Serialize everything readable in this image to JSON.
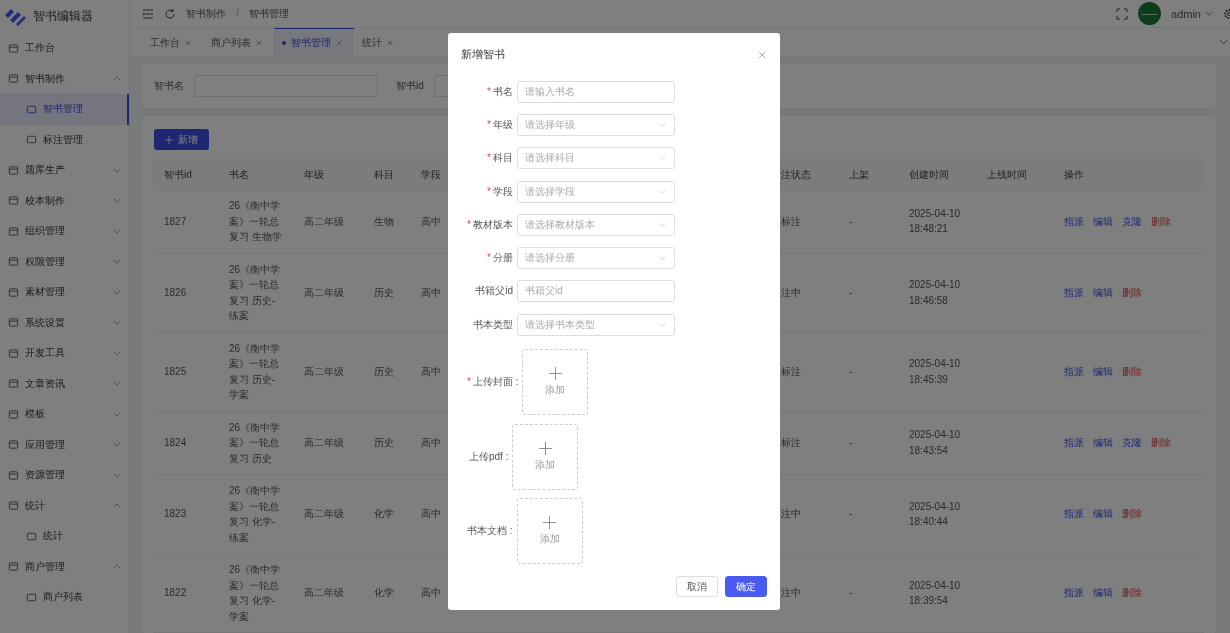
{
  "app": {
    "title": "智书编辑器"
  },
  "sidebar": {
    "items": [
      {
        "label": "工作台"
      },
      {
        "label": "智书制作",
        "expanded": true,
        "children": [
          {
            "label": "智书管理",
            "selected": true
          },
          {
            "label": "标注管理",
            "selected": false
          }
        ]
      },
      {
        "label": "题库生产",
        "expanded": false
      },
      {
        "label": "校本制作",
        "expanded": false
      },
      {
        "label": "组织管理",
        "expanded": false
      },
      {
        "label": "权限管理",
        "expanded": false
      },
      {
        "label": "素材管理",
        "expanded": false
      },
      {
        "label": "系统设置",
        "expanded": false
      },
      {
        "label": "开发工具",
        "expanded": false
      },
      {
        "label": "文章资讯",
        "expanded": false
      },
      {
        "label": "模板",
        "expanded": false
      },
      {
        "label": "应用管理",
        "expanded": false
      },
      {
        "label": "资源管理",
        "expanded": false
      },
      {
        "label": "统计",
        "expanded": true,
        "children": [
          {
            "label": "统计",
            "selected": false
          }
        ]
      },
      {
        "label": "商户管理",
        "expanded": true,
        "children": [
          {
            "label": "商户列表",
            "selected": false
          }
        ]
      }
    ]
  },
  "header": {
    "breadcrumb": [
      "智书制作",
      "智书管理"
    ],
    "separator": "/",
    "user": "admin"
  },
  "tabs": [
    {
      "label": "工作台",
      "selected": false
    },
    {
      "label": "商户列表",
      "selected": false
    },
    {
      "label": "智书管理",
      "selected": true
    },
    {
      "label": "统计",
      "selected": false
    }
  ],
  "search": {
    "fields": [
      {
        "label": "智书名"
      },
      {
        "label": "智书id"
      }
    ]
  },
  "add_button": "新增",
  "table": {
    "columns": [
      "智书id",
      "书名",
      "年级",
      "科目",
      "学段",
      "注状态",
      "上架",
      "创建时间",
      "上线时间",
      "操作"
    ],
    "rows": [
      {
        "id": "1827",
        "name": "26《衡中学案》一轮总复习 生物学",
        "grade": "高二年级",
        "subject": "生物",
        "stage": "高中",
        "status": "标注",
        "shelf": "-",
        "created": "2025-04-10 18:48:21",
        "actions": [
          {
            "label": "指派",
            "kind": "link"
          },
          {
            "label": "编辑",
            "kind": "link"
          },
          {
            "label": "克隆",
            "kind": "link"
          },
          {
            "label": "删除",
            "kind": "danger"
          }
        ]
      },
      {
        "id": "1826",
        "name": "26《衡中学案》一轮总复习 历史-练案",
        "grade": "高二年级",
        "subject": "历史",
        "stage": "高中",
        "status": "注中",
        "shelf": "-",
        "created": "2025-04-10 18:46:58",
        "actions": [
          {
            "label": "指派",
            "kind": "link"
          },
          {
            "label": "编辑",
            "kind": "link"
          },
          {
            "label": "删除",
            "kind": "danger"
          }
        ]
      },
      {
        "id": "1825",
        "name": "26《衡中学案》一轮总复习 历史-学案",
        "grade": "高二年级",
        "subject": "历史",
        "stage": "高中",
        "status": "标注",
        "shelf": "-",
        "created": "2025-04-10 18:45:39",
        "actions": [
          {
            "label": "指派",
            "kind": "link"
          },
          {
            "label": "编辑",
            "kind": "link"
          },
          {
            "label": "删除",
            "kind": "danger"
          }
        ]
      },
      {
        "id": "1824",
        "name": "26《衡中学案》一轮总复习 历史",
        "grade": "高二年级",
        "subject": "历史",
        "stage": "高中",
        "status": "标注",
        "shelf": "-",
        "created": "2025-04-10 18:43:54",
        "actions": [
          {
            "label": "指派",
            "kind": "link"
          },
          {
            "label": "编辑",
            "kind": "link"
          },
          {
            "label": "克隆",
            "kind": "link"
          },
          {
            "label": "删除",
            "kind": "danger"
          }
        ]
      },
      {
        "id": "1823",
        "name": "26《衡中学案》一轮总复习 化学-练案",
        "grade": "高二年级",
        "subject": "化学",
        "stage": "高中",
        "status": "注中",
        "shelf": "-",
        "created": "2025-04-10 18:40:44",
        "actions": [
          {
            "label": "指派",
            "kind": "link"
          },
          {
            "label": "编辑",
            "kind": "link"
          },
          {
            "label": "删除",
            "kind": "danger"
          }
        ]
      },
      {
        "id": "1822",
        "name": "26《衡中学案》一轮总复习 化学-学案",
        "grade": "高二年级",
        "subject": "化学",
        "stage": "高中",
        "status": "注中",
        "shelf": "-",
        "created": "2025-04-10 18:39:54",
        "actions": [
          {
            "label": "指派",
            "kind": "link"
          },
          {
            "label": "编辑",
            "kind": "link"
          },
          {
            "label": "删除",
            "kind": "danger"
          }
        ]
      }
    ]
  },
  "dialog": {
    "title": "新增智书",
    "required_mark": "*",
    "fields": [
      {
        "kind": "input",
        "label": "书名",
        "required": true,
        "placeholder": "请输入书名"
      },
      {
        "kind": "select",
        "label": "年级",
        "required": true,
        "placeholder": "请选择年级"
      },
      {
        "kind": "select",
        "label": "科目",
        "required": true,
        "placeholder": "请选择科目"
      },
      {
        "kind": "select",
        "label": "学段",
        "required": true,
        "placeholder": "请选择学段"
      },
      {
        "kind": "select",
        "label": "教材版本",
        "required": true,
        "placeholder": "请选择教材版本"
      },
      {
        "kind": "select",
        "label": "分册",
        "required": true,
        "placeholder": "请选择分册"
      },
      {
        "kind": "input",
        "label": "书籍父id",
        "required": false,
        "placeholder": "书籍父id"
      },
      {
        "kind": "select",
        "label": "书本类型",
        "required": false,
        "placeholder": "请选择书本类型"
      },
      {
        "kind": "upload",
        "label": "上传封面 :",
        "required": true,
        "button": "添加"
      },
      {
        "kind": "upload",
        "label": "上传pdf :",
        "required": false,
        "button": "添加"
      },
      {
        "kind": "upload",
        "label": "书本文档 :",
        "required": false,
        "button": "添加"
      }
    ],
    "buttons": [
      {
        "label": "取消",
        "kind": "default"
      },
      {
        "label": "确定",
        "kind": "primary"
      }
    ]
  }
}
